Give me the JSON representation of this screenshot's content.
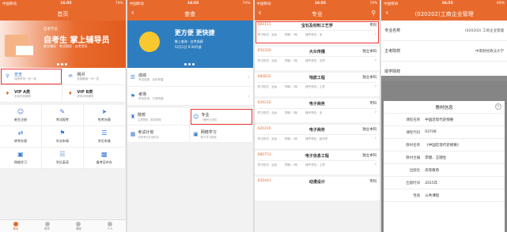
{
  "status": {
    "carrier": "中国移动",
    "time": "16:55",
    "battery": "74%"
  },
  "status4": {
    "carrier": "中国移动",
    "time": "16:55",
    "battery": "69%"
  },
  "screen1": {
    "title": "首页",
    "banner": {
      "small": "自考学员",
      "big": "自考生 掌上辅导员",
      "sub": "教学辅导 · 考试指导 · 自考资讯"
    },
    "menu": [
      {
        "label": "查查",
        "sub": "成绩考场一查一准",
        "icon": "search-icon"
      },
      {
        "label": "网问",
        "sub": "答疑解惑一问一答",
        "icon": "chat-icon"
      },
      {
        "label": "VIP A类",
        "sub": "名师在线辅导",
        "icon": "vip-icon"
      },
      {
        "label": "VIP B类",
        "sub": "考前冲刺辅导",
        "icon": "vip-icon"
      }
    ],
    "grid": [
      {
        "label": "新生注册",
        "icon": "user-icon"
      },
      {
        "label": "考试报考",
        "icon": "edit-icon"
      },
      {
        "label": "免考办理",
        "icon": "send-icon"
      },
      {
        "label": "转考办理",
        "icon": "swap-icon"
      },
      {
        "label": "毕业申请",
        "icon": "grad-icon"
      },
      {
        "label": "学位申请",
        "icon": "doc-icon"
      },
      {
        "label": "网络学习",
        "icon": "monitor-icon"
      },
      {
        "label": "学位英语",
        "icon": "book-icon"
      },
      {
        "label": "备考证补办",
        "icon": "card-icon"
      }
    ],
    "tabs": [
      "首页",
      "助学",
      "课程",
      "个人"
    ]
  },
  "screen2": {
    "title": "查查",
    "banner": {
      "t1": "更方便 更快捷",
      "t2": "掌上查询 · 自考成绩",
      "t3": "12月1日 9:30开放"
    },
    "rows": [
      {
        "label": "成绩",
        "sub": "考试成绩，及时掌握"
      },
      {
        "label": "考场",
        "sub": "考场查询，方便快捷"
      }
    ],
    "grid": [
      {
        "label": "院校",
        "sub": "主考院校，助学院校"
      },
      {
        "label": "专业",
        "sub": "了解专业详情"
      },
      {
        "label": "考试计划",
        "sub": "自考考试计划科目"
      },
      {
        "label": "网络学习",
        "sub": "助力学习视频"
      }
    ]
  },
  "screen3": {
    "title": "专业",
    "items": [
      {
        "code": "080111",
        "name": "宝石及材料工艺学",
        "level": "专科",
        "type": "学习形式：业余",
        "years": "学制：3年",
        "cat": "授予学位：无"
      },
      {
        "code": "050320",
        "name": "大众传播",
        "level": "独立本科",
        "type": "学习形式：业余",
        "years": "学制：2年",
        "cat": "授予学位：文学"
      },
      {
        "code": "080835",
        "name": "地质工程",
        "level": "独立本科",
        "type": "学习形式：业余",
        "years": "学制：2年",
        "cat": "授予学位：工学"
      },
      {
        "code": "020216",
        "name": "电子商务",
        "level": "专科",
        "type": "学习形式：业余",
        "years": "学制：3年",
        "cat": "授予学位：无"
      },
      {
        "code": "020216",
        "name": "电子商务",
        "level": "独立本科",
        "type": "学习形式：业余",
        "years": "学制：2年",
        "cat": "授予学位：经济学"
      },
      {
        "code": "080753",
        "name": "电子信息工程",
        "level": "独立本科",
        "type": "学习形式：业余",
        "years": "学制：2年",
        "cat": "授予学位：工学"
      },
      {
        "code": "050441",
        "name": "动漫设计",
        "level": "专科",
        "type": "",
        "years": "",
        "cat": ""
      }
    ]
  },
  "screen4": {
    "title": "(020202)工商企业管理",
    "rows": [
      {
        "label": "专业名称",
        "value": "(020202) 工商企业管理"
      },
      {
        "label": "主考院校",
        "value": "中南财经政法大学"
      },
      {
        "label": "助学院校",
        "value": ""
      }
    ],
    "dialog": {
      "title": "教材信息",
      "rows": [
        {
          "k": "课程名称",
          "v": "中国近现代史纲要"
        },
        {
          "k": "课程代码",
          "v": "03708"
        },
        {
          "k": "教材名称",
          "v": "《中国近现代史纲要》"
        },
        {
          "k": "教材主编",
          "v": "李捷、王顺生"
        },
        {
          "k": "出版社",
          "v": "高等教育"
        },
        {
          "k": "出版时间",
          "v": "2015年"
        },
        {
          "k": "性质",
          "v": "公共课程"
        }
      ]
    }
  }
}
